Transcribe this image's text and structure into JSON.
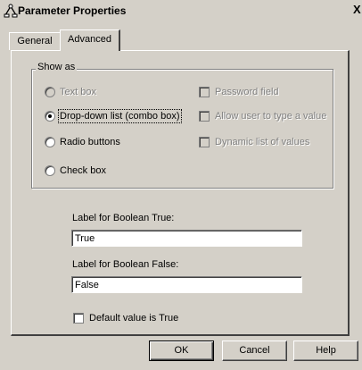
{
  "window": {
    "title": "Parameter Properties",
    "close_glyph": "X"
  },
  "tabs": [
    {
      "label": "General",
      "active": false
    },
    {
      "label": "Advanced",
      "active": true
    }
  ],
  "show_as": {
    "legend": "Show as",
    "radios": [
      {
        "label": "Text box",
        "checked": false,
        "enabled": false
      },
      {
        "label": "Drop-down list (combo box)",
        "checked": true,
        "enabled": true
      },
      {
        "label": "Radio buttons",
        "checked": false,
        "enabled": true
      },
      {
        "label": "Check box",
        "checked": false,
        "enabled": true
      }
    ],
    "checkboxes": [
      {
        "label": "Password field",
        "checked": false,
        "enabled": false
      },
      {
        "label": "Allow user to type a value",
        "checked": false,
        "enabled": false
      },
      {
        "label": "Dynamic list of values",
        "checked": false,
        "enabled": false
      }
    ]
  },
  "boolean_labels": {
    "true_label": "Label for Boolean True:",
    "true_value": "True",
    "false_label": "Label for Boolean False:",
    "false_value": "False"
  },
  "default_checkbox": {
    "label": "Default value is True",
    "checked": false
  },
  "buttons": {
    "ok": "OK",
    "cancel": "Cancel",
    "help": "Help"
  }
}
